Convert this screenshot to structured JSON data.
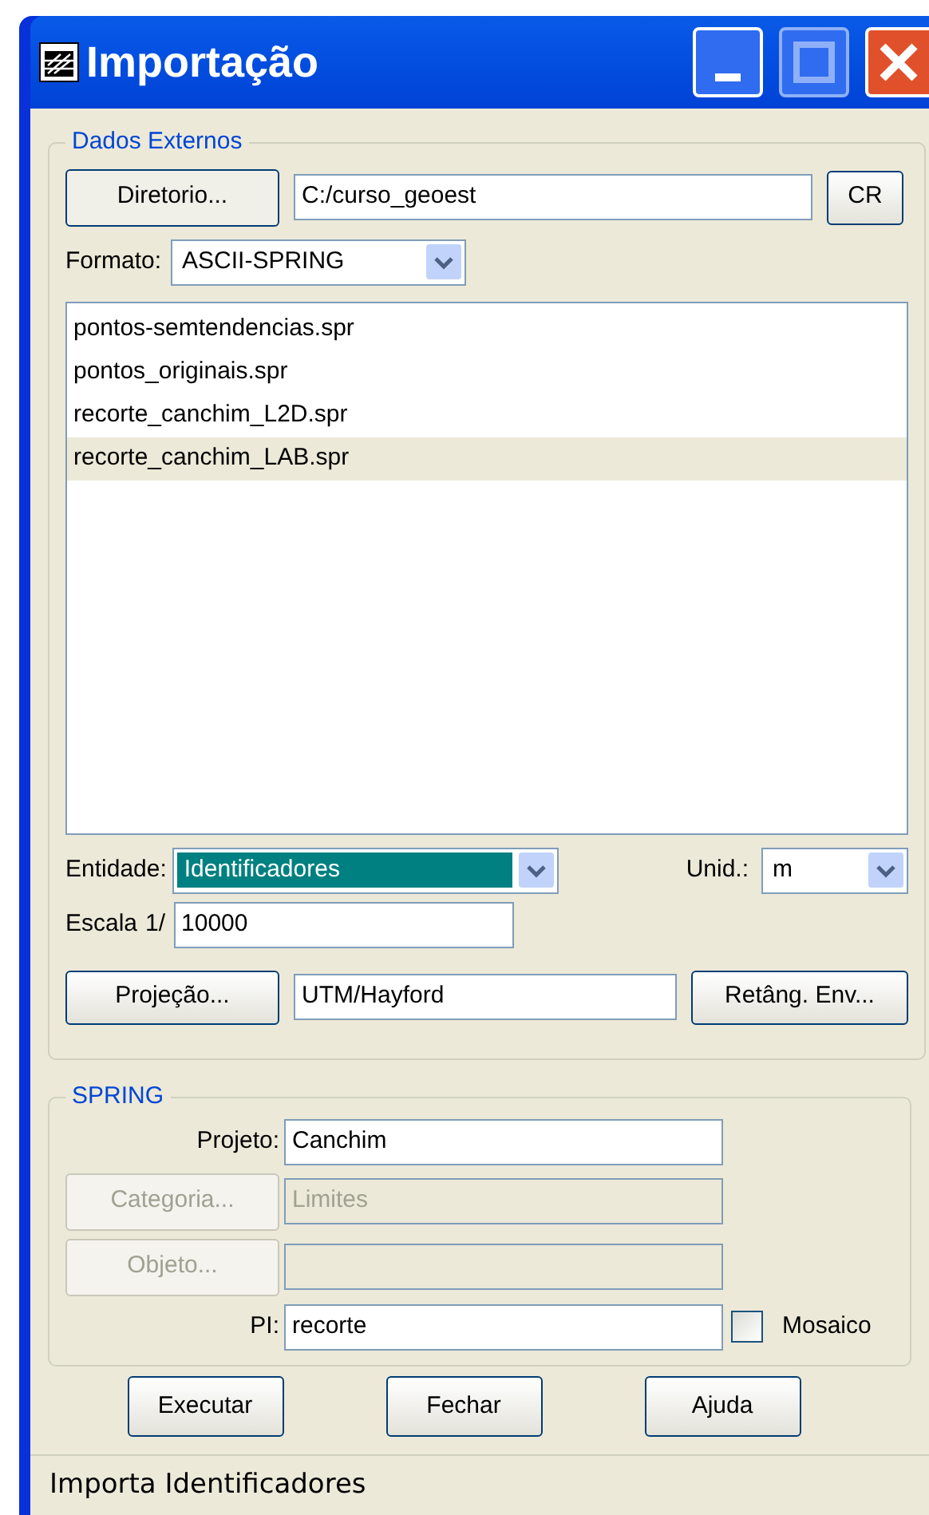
{
  "window": {
    "title": "Importação"
  },
  "external": {
    "legend": "Dados Externos",
    "directory_button": "Diretorio...",
    "directory": "C:/curso_geoest",
    "cr_button": "CR",
    "format_label": "Formato:",
    "format": "ASCII-SPRING",
    "files": [
      {
        "name": "pontos-semtendencias.spr",
        "selected": false
      },
      {
        "name": "pontos_originais.spr",
        "selected": false
      },
      {
        "name": "recorte_canchim_L2D.spr",
        "selected": false
      },
      {
        "name": "recorte_canchim_LAB.spr",
        "selected": true
      }
    ],
    "entity_label": "Entidade:",
    "entity": "Identificadores",
    "entity_focused": true,
    "unit_label": "Unid.:",
    "unit": "m",
    "scale_label": "Escala",
    "scale_prefix": "1/",
    "scale": "10000",
    "projection_button": "Projeção...",
    "projection": "UTM/Hayford",
    "envelope_button": "Retâng. Env..."
  },
  "spring": {
    "legend": "SPRING",
    "rows": [
      {
        "kind": "label",
        "label": "Projeto:",
        "value": "Canchim",
        "disabled": false
      },
      {
        "kind": "button",
        "label": "Categoria...",
        "value": "Limites",
        "disabled": true
      },
      {
        "kind": "button",
        "label": "Objeto...",
        "disabled": true
      },
      {
        "kind": "label",
        "label": "PI:",
        "value": "recorte",
        "disabled": false,
        "checkbox": {
          "label": "Mosaico",
          "checked": false
        }
      }
    ]
  },
  "buttons": [
    "Executar",
    "Fechar",
    "Ajuda"
  ],
  "status_bar": "Importa Identificadores"
}
